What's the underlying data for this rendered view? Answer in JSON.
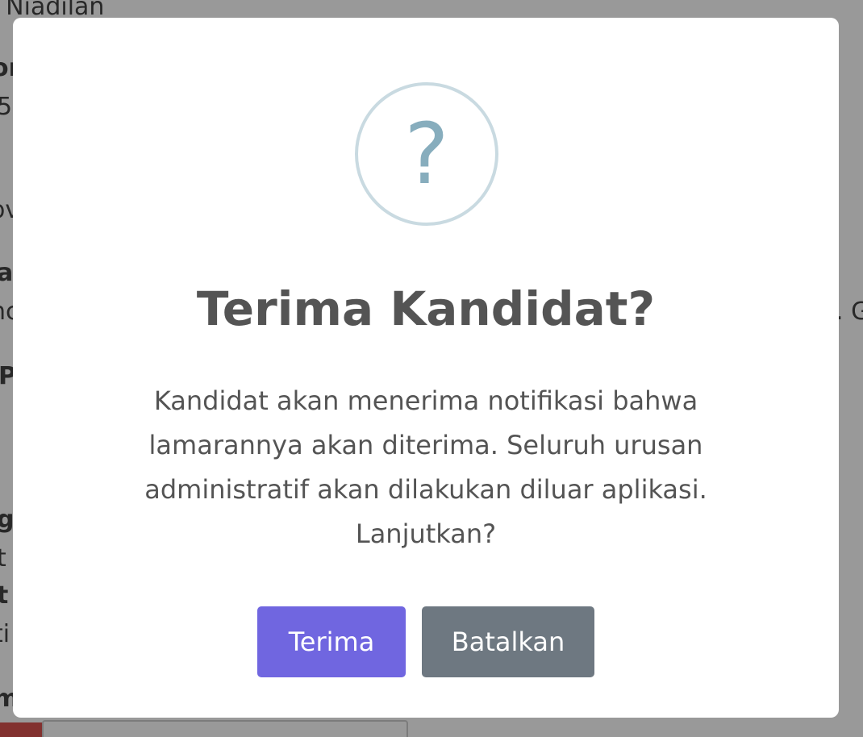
{
  "background_page": {
    "fragments": [
      {
        "text": "s Niadilan"
      },
      {
        "text": "or"
      },
      {
        "text": "5"
      },
      {
        "text": "ov"
      },
      {
        "text": "a"
      },
      {
        "text": "nc"
      },
      {
        "text": ". G"
      },
      {
        "text": "P"
      },
      {
        "text": "g"
      },
      {
        "text": "t"
      },
      {
        "text": "t"
      },
      {
        "text": "ti"
      },
      {
        "text": "m"
      }
    ]
  },
  "modal": {
    "icon": "question-icon",
    "icon_glyph": "?",
    "title": "Terima Kandidat?",
    "message": "Kandidat akan menerima notifikasi bahwa lamarannya akan diterima. Seluruh urusan administratif akan dilakukan diluar aplikasi. Lanjutkan?",
    "confirm_label": "Terima",
    "cancel_label": "Batalkan"
  },
  "colors": {
    "confirm": "#7066e0",
    "cancel": "#6e7881",
    "icon": "#87adbd",
    "icon_ring": "#c9dae1",
    "text": "#545454"
  }
}
